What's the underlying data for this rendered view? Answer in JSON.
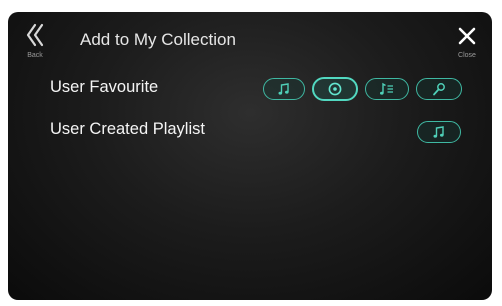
{
  "header": {
    "back_label": "Back",
    "title": "Add to My Collection",
    "close_label": "Close"
  },
  "rows": [
    {
      "label": "User Favourite",
      "buttons": [
        {
          "icon": "music-note-icon",
          "selected": false
        },
        {
          "icon": "disc-icon",
          "selected": true
        },
        {
          "icon": "playlist-icon",
          "selected": false
        },
        {
          "icon": "microphone-icon",
          "selected": false
        }
      ]
    },
    {
      "label": "User Created Playlist",
      "buttons": [
        {
          "icon": "music-note-icon",
          "selected": false
        }
      ]
    }
  ],
  "colors": {
    "accent": "#3fb8a2",
    "background": "#1c1c1c",
    "text": "#f5f5f5"
  }
}
